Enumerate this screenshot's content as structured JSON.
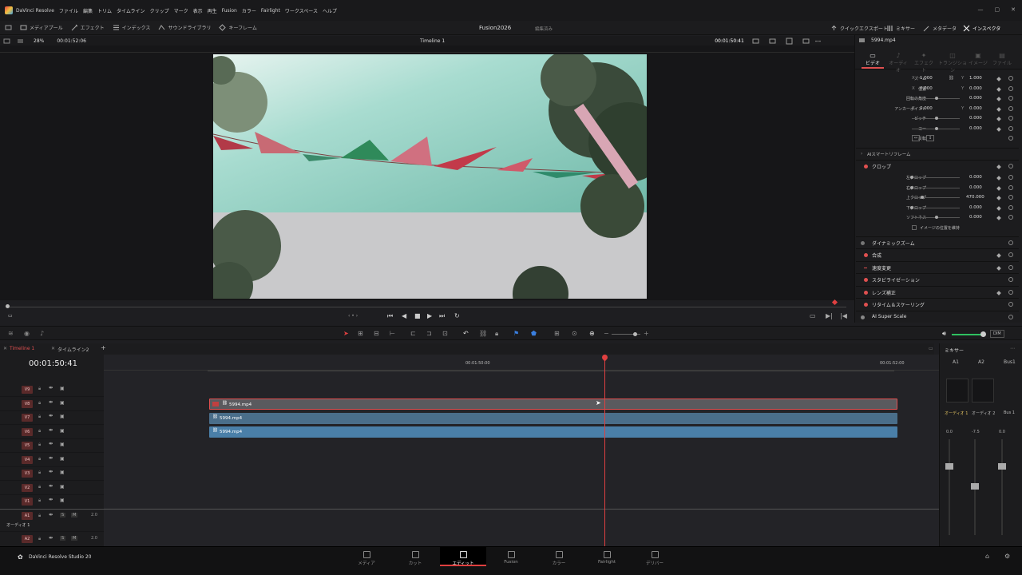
{
  "menu": {
    "app": "DaVinci Resolve",
    "items": [
      "ファイル",
      "編集",
      "トリム",
      "タイムライン",
      "クリップ",
      "マーク",
      "表示",
      "再生",
      "Fusion",
      "カラー",
      "Fairlight",
      "ワークスペース",
      "ヘルプ"
    ]
  },
  "toolbar": {
    "media_pool": "メディアプール",
    "effects": "エフェクト",
    "index": "インデックス",
    "sound_library": "サウンドライブラリ",
    "keyframes": "キーフレーム",
    "project_title": "Fusion2026",
    "project_status": "編集済み",
    "quick_export": "クイックエクスポート",
    "mixer": "ミキサー",
    "metadata": "メタデータ",
    "inspector": "インスペクタ"
  },
  "viewer": {
    "zoom": "28%",
    "source_timecode": "00:01:52:06",
    "timeline_name": "Timeline 1",
    "timeline_timecode": "00:01:50:41",
    "clip_name": "5994.mp4"
  },
  "inspector": {
    "tabs": [
      "ビデオ",
      "オーディオ",
      "エフェクト",
      "トランジション",
      "イメージ",
      "ファイル"
    ],
    "transform": [
      {
        "label": "ズーム",
        "x": "1.000",
        "y": "1.000"
      },
      {
        "label": "位置",
        "x": "0.000",
        "y": "0.000"
      },
      {
        "label": "回転の角度",
        "v": "0.000"
      },
      {
        "label": "アンカーポイント",
        "x": "0.000",
        "y": "0.000"
      },
      {
        "label": "ピッチ",
        "v": "0.000"
      },
      {
        "label": "ヨー",
        "v": "0.000"
      },
      {
        "label": "反転"
      }
    ],
    "ai_smart_reframe": "AIスマートリフレーム",
    "crop_title": "クロップ",
    "crop": [
      {
        "label": "左クロップ",
        "v": "0.000"
      },
      {
        "label": "右クロップ",
        "v": "0.000"
      },
      {
        "label": "上クロップ",
        "v": "470.000"
      },
      {
        "label": "下クロップ",
        "v": "0.000"
      },
      {
        "label": "ソフトネス",
        "v": "0.000"
      }
    ],
    "retain_position": "イメージの位置を維持",
    "sections": [
      "ダイナミックズーム",
      "合成",
      "速度変更",
      "スタビライゼーション",
      "レンズ補正",
      "リタイム＆スケーリング",
      "AI Super Scale"
    ]
  },
  "timeline": {
    "tabs": [
      "Timeline 1",
      "タイムライン2"
    ],
    "timecode": "00:01:50:41",
    "ruler": [
      "00:01:50:00",
      "00:01:52:00"
    ],
    "video_tracks": [
      "V9",
      "V8",
      "V7",
      "V6",
      "V5",
      "V4",
      "V3",
      "V2",
      "V1"
    ],
    "audio_tracks": [
      "A1",
      "A2"
    ],
    "audio_label": "オーディオ 1",
    "audio_level": "2.0",
    "clips": [
      "5994.mp4",
      "5994.mp4",
      "5994.mp4"
    ]
  },
  "mixer": {
    "title": "ミキサー",
    "channels": [
      "A1",
      "A2",
      "Bus1"
    ],
    "names": [
      "オーディオ 1",
      "オーディオ 2",
      "Bus 1"
    ],
    "levels": [
      "0.0",
      "-7.5",
      "0.0"
    ],
    "dim": "DIM"
  },
  "pages": [
    "メディア",
    "カット",
    "エディット",
    "Fusion",
    "カラー",
    "Fairlight",
    "デリバー"
  ],
  "footer": {
    "product": "DaVinci Resolve Studio 20"
  },
  "colors": {
    "accent": "#e05050",
    "clip_blue": "#4a7fa8",
    "playhead": "#e04040"
  }
}
